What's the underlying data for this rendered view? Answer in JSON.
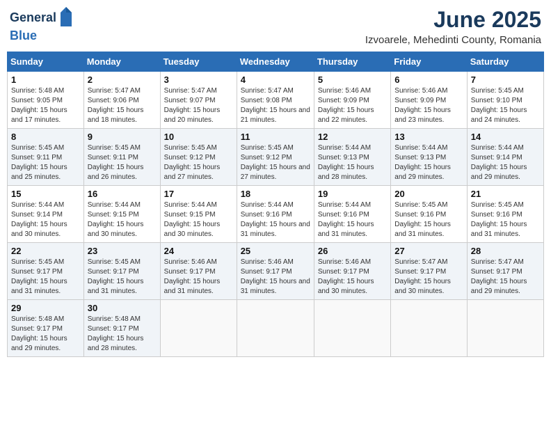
{
  "header": {
    "logo_general": "General",
    "logo_blue": "Blue",
    "month_title": "June 2025",
    "location": "Izvoarele, Mehedinti County, Romania"
  },
  "days_of_week": [
    "Sunday",
    "Monday",
    "Tuesday",
    "Wednesday",
    "Thursday",
    "Friday",
    "Saturday"
  ],
  "weeks": [
    [
      {
        "day": "1",
        "sunrise": "5:48 AM",
        "sunset": "9:05 PM",
        "daylight": "15 hours and 17 minutes."
      },
      {
        "day": "2",
        "sunrise": "5:47 AM",
        "sunset": "9:06 PM",
        "daylight": "15 hours and 18 minutes."
      },
      {
        "day": "3",
        "sunrise": "5:47 AM",
        "sunset": "9:07 PM",
        "daylight": "15 hours and 20 minutes."
      },
      {
        "day": "4",
        "sunrise": "5:47 AM",
        "sunset": "9:08 PM",
        "daylight": "15 hours and 21 minutes."
      },
      {
        "day": "5",
        "sunrise": "5:46 AM",
        "sunset": "9:09 PM",
        "daylight": "15 hours and 22 minutes."
      },
      {
        "day": "6",
        "sunrise": "5:46 AM",
        "sunset": "9:09 PM",
        "daylight": "15 hours and 23 minutes."
      },
      {
        "day": "7",
        "sunrise": "5:45 AM",
        "sunset": "9:10 PM",
        "daylight": "15 hours and 24 minutes."
      }
    ],
    [
      {
        "day": "8",
        "sunrise": "5:45 AM",
        "sunset": "9:11 PM",
        "daylight": "15 hours and 25 minutes."
      },
      {
        "day": "9",
        "sunrise": "5:45 AM",
        "sunset": "9:11 PM",
        "daylight": "15 hours and 26 minutes."
      },
      {
        "day": "10",
        "sunrise": "5:45 AM",
        "sunset": "9:12 PM",
        "daylight": "15 hours and 27 minutes."
      },
      {
        "day": "11",
        "sunrise": "5:45 AM",
        "sunset": "9:12 PM",
        "daylight": "15 hours and 27 minutes."
      },
      {
        "day": "12",
        "sunrise": "5:44 AM",
        "sunset": "9:13 PM",
        "daylight": "15 hours and 28 minutes."
      },
      {
        "day": "13",
        "sunrise": "5:44 AM",
        "sunset": "9:13 PM",
        "daylight": "15 hours and 29 minutes."
      },
      {
        "day": "14",
        "sunrise": "5:44 AM",
        "sunset": "9:14 PM",
        "daylight": "15 hours and 29 minutes."
      }
    ],
    [
      {
        "day": "15",
        "sunrise": "5:44 AM",
        "sunset": "9:14 PM",
        "daylight": "15 hours and 30 minutes."
      },
      {
        "day": "16",
        "sunrise": "5:44 AM",
        "sunset": "9:15 PM",
        "daylight": "15 hours and 30 minutes."
      },
      {
        "day": "17",
        "sunrise": "5:44 AM",
        "sunset": "9:15 PM",
        "daylight": "15 hours and 30 minutes."
      },
      {
        "day": "18",
        "sunrise": "5:44 AM",
        "sunset": "9:16 PM",
        "daylight": "15 hours and 31 minutes."
      },
      {
        "day": "19",
        "sunrise": "5:44 AM",
        "sunset": "9:16 PM",
        "daylight": "15 hours and 31 minutes."
      },
      {
        "day": "20",
        "sunrise": "5:45 AM",
        "sunset": "9:16 PM",
        "daylight": "15 hours and 31 minutes."
      },
      {
        "day": "21",
        "sunrise": "5:45 AM",
        "sunset": "9:16 PM",
        "daylight": "15 hours and 31 minutes."
      }
    ],
    [
      {
        "day": "22",
        "sunrise": "5:45 AM",
        "sunset": "9:17 PM",
        "daylight": "15 hours and 31 minutes."
      },
      {
        "day": "23",
        "sunrise": "5:45 AM",
        "sunset": "9:17 PM",
        "daylight": "15 hours and 31 minutes."
      },
      {
        "day": "24",
        "sunrise": "5:46 AM",
        "sunset": "9:17 PM",
        "daylight": "15 hours and 31 minutes."
      },
      {
        "day": "25",
        "sunrise": "5:46 AM",
        "sunset": "9:17 PM",
        "daylight": "15 hours and 31 minutes."
      },
      {
        "day": "26",
        "sunrise": "5:46 AM",
        "sunset": "9:17 PM",
        "daylight": "15 hours and 30 minutes."
      },
      {
        "day": "27",
        "sunrise": "5:47 AM",
        "sunset": "9:17 PM",
        "daylight": "15 hours and 30 minutes."
      },
      {
        "day": "28",
        "sunrise": "5:47 AM",
        "sunset": "9:17 PM",
        "daylight": "15 hours and 29 minutes."
      }
    ],
    [
      {
        "day": "29",
        "sunrise": "5:48 AM",
        "sunset": "9:17 PM",
        "daylight": "15 hours and 29 minutes."
      },
      {
        "day": "30",
        "sunrise": "5:48 AM",
        "sunset": "9:17 PM",
        "daylight": "15 hours and 28 minutes."
      },
      null,
      null,
      null,
      null,
      null
    ]
  ]
}
